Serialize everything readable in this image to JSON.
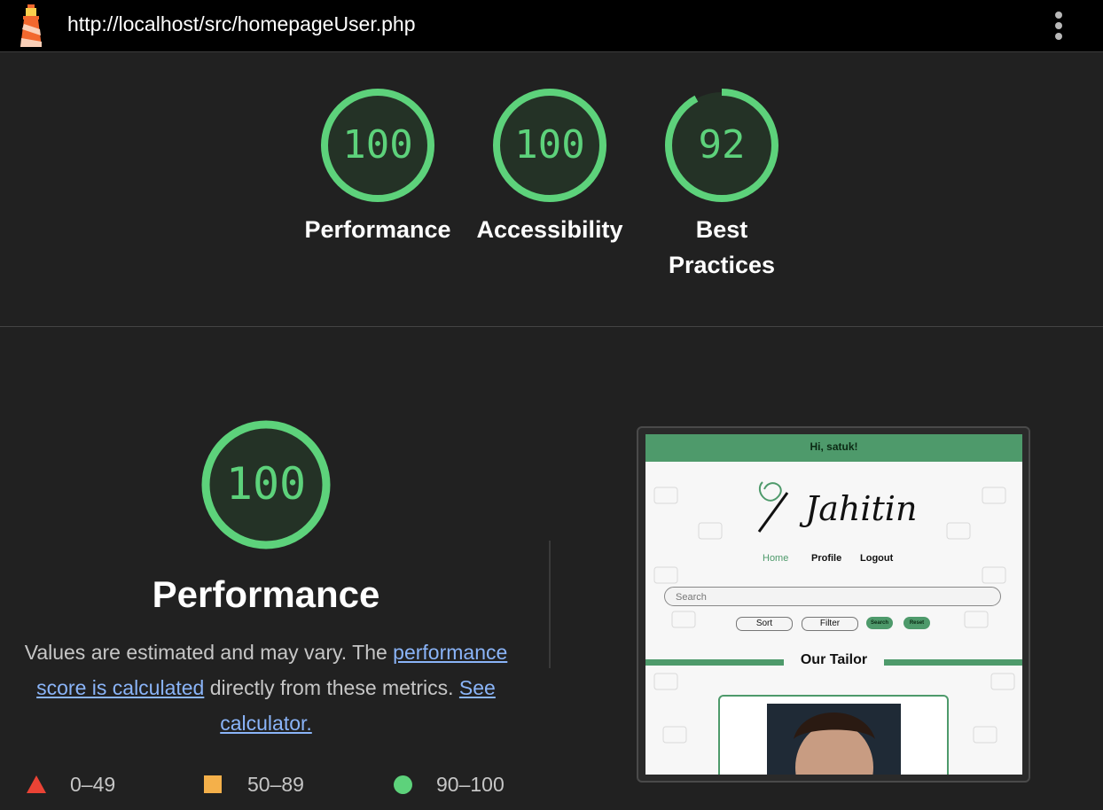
{
  "header": {
    "url": "http://localhost/src/homepageUser.php",
    "logo_icon": "lighthouse-icon",
    "menu_icon": "kebab-menu-icon"
  },
  "scores": [
    {
      "label": "Performance",
      "value": 100
    },
    {
      "label": "Accessibility",
      "value": 100
    },
    {
      "label": "Best Practices",
      "label_line1": "Best",
      "label_line2": "Practices",
      "value": 92
    }
  ],
  "performance": {
    "score": 100,
    "title": "Performance",
    "desc_pre": "Values are estimated and may vary. The ",
    "desc_link1": "performance score is calculated",
    "desc_mid": " directly from these metrics. ",
    "desc_link2": "See calculator."
  },
  "legend": [
    {
      "range": "0–49",
      "color": "#ea4335",
      "shape": "triangle"
    },
    {
      "range": "50–89",
      "color": "#f4b04a",
      "shape": "square"
    },
    {
      "range": "90–100",
      "color": "#5dd27b",
      "shape": "circle"
    }
  ],
  "colors": {
    "pass": "#5dd27b",
    "background": "#212121",
    "accent_green": "#4e9a6b"
  },
  "screenshot": {
    "greeting": "Hi, satuk!",
    "brand": "Jahitin",
    "nav": [
      "Home",
      "Profile",
      "Logout"
    ],
    "search_placeholder": "Search",
    "sort_label": "Sort",
    "filter_label": "Filter",
    "search_button": "Search",
    "reset_button": "Reset",
    "section_title": "Our Tailor"
  }
}
